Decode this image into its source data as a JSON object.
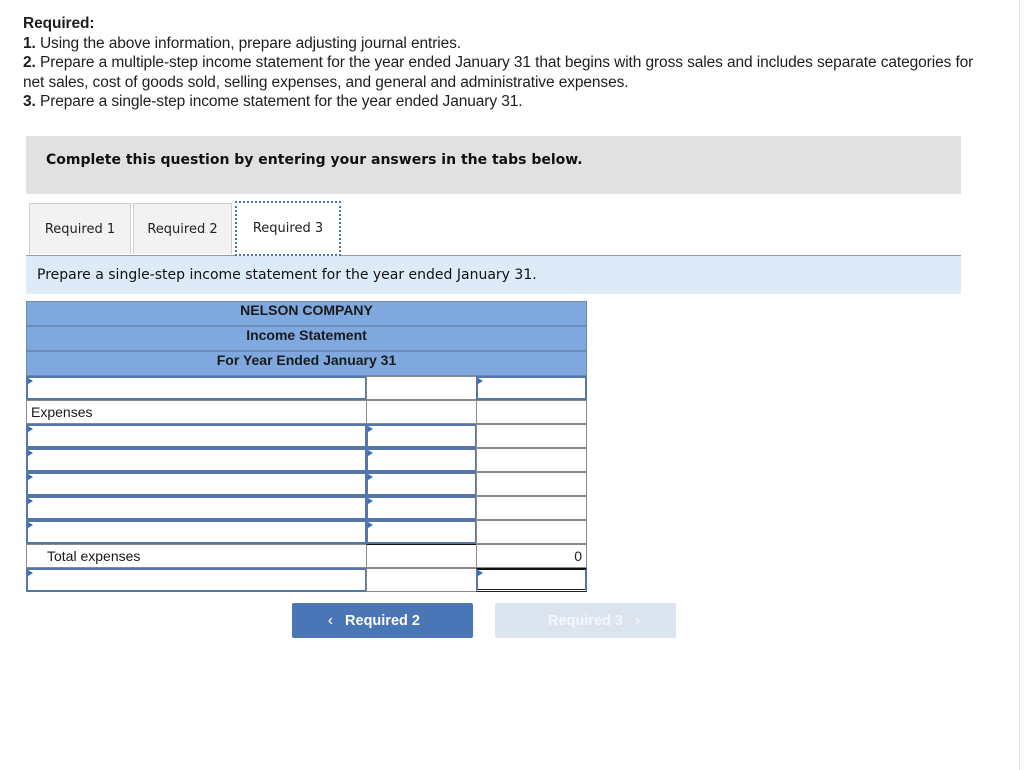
{
  "required": {
    "heading": "Required:",
    "items": [
      {
        "num": "1.",
        "text": "Using the above information, prepare adjusting journal entries."
      },
      {
        "num": "2.",
        "text": "Prepare a multiple-step income statement for the year ended January 31 that begins with gross sales and includes separate categories for net sales, cost of goods sold, selling expenses, and general and administrative expenses."
      },
      {
        "num": "3.",
        "text": "Prepare a single-step income statement for the year ended January 31."
      }
    ]
  },
  "banner": "Complete this question by entering your answers in the tabs below.",
  "tabs": [
    {
      "label": "Required 1",
      "active": false
    },
    {
      "label": "Required 2",
      "active": false
    },
    {
      "label": "Required 3",
      "active": true
    }
  ],
  "instruction": "Prepare a single-step income statement for the year ended January 31.",
  "statement": {
    "company": "NELSON COMPANY",
    "title": "Income Statement",
    "period": "For Year Ended January 31",
    "expenses_label": "Expenses",
    "total_expenses_label": "Total expenses",
    "total_expenses_value": "0",
    "inputs": {
      "revenue_label": "",
      "revenue_amount": "",
      "expense_rows": [
        {
          "label": "",
          "amount": ""
        },
        {
          "label": "",
          "amount": ""
        },
        {
          "label": "",
          "amount": ""
        },
        {
          "label": "",
          "amount": ""
        },
        {
          "label": "",
          "amount": ""
        }
      ],
      "net_label": "",
      "net_amount": ""
    }
  },
  "nav": {
    "prev_label": "Required 2",
    "next_label": "Required 3",
    "prev_icon": "chevron-left-icon",
    "next_icon": "chevron-right-icon"
  }
}
